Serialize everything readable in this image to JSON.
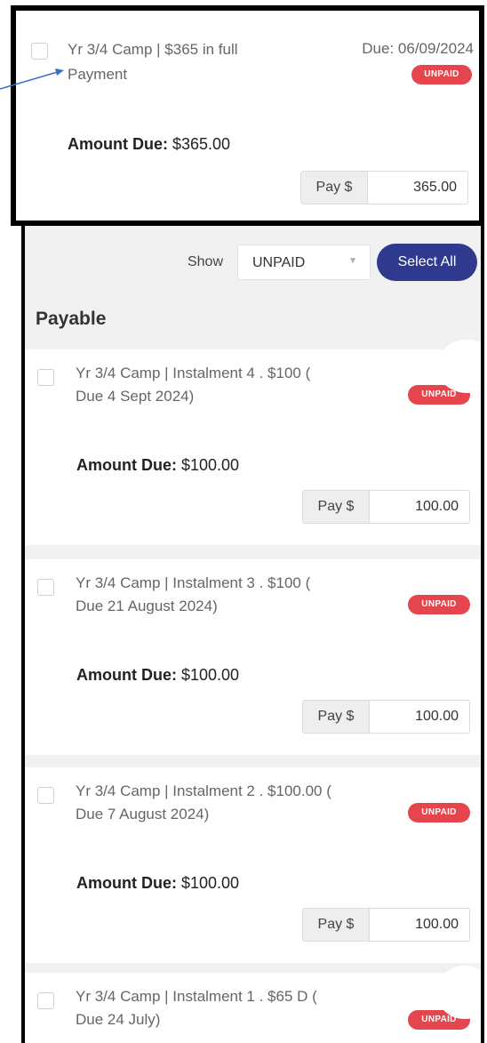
{
  "callout": {
    "description": "Yr 3/4 Camp | $365 in full Payment",
    "due": "Due: 06/09/2024",
    "status": "UNPAID",
    "amount_label": "Amount Due:",
    "amount_value": "$365.00",
    "pay_prefix": "Pay $",
    "pay_value": "365.00"
  },
  "filter": {
    "show_label": "Show",
    "selected_status": "UNPAID",
    "select_all_label": "Select All"
  },
  "section_title": "Payable",
  "items": [
    {
      "description": "Yr 3/4 Camp | Instalment 4 . $100 ( Due 4 Sept 2024)",
      "status": "UNPAID",
      "amount_label": "Amount Due:",
      "amount_value": "$100.00",
      "pay_prefix": "Pay $",
      "pay_value": "100.00"
    },
    {
      "description": "Yr 3/4 Camp | Instalment 3 . $100 ( Due 21 August 2024)",
      "status": "UNPAID",
      "amount_label": "Amount Due:",
      "amount_value": "$100.00",
      "pay_prefix": "Pay $",
      "pay_value": "100.00"
    },
    {
      "description": "Yr 3/4 Camp | Instalment 2 . $100.00 ( Due 7 August 2024)",
      "status": "UNPAID",
      "amount_label": "Amount Due:",
      "amount_value": "$100.00",
      "pay_prefix": "Pay $",
      "pay_value": "100.00"
    },
    {
      "description": "Yr 3/4 Camp | Instalment 1 . $65 D ( Due 24 July)",
      "status": "UNPAID"
    }
  ],
  "colors": {
    "accent": "#2f3a8f",
    "badge": "#e5454d",
    "background": "#f1f1f1"
  }
}
